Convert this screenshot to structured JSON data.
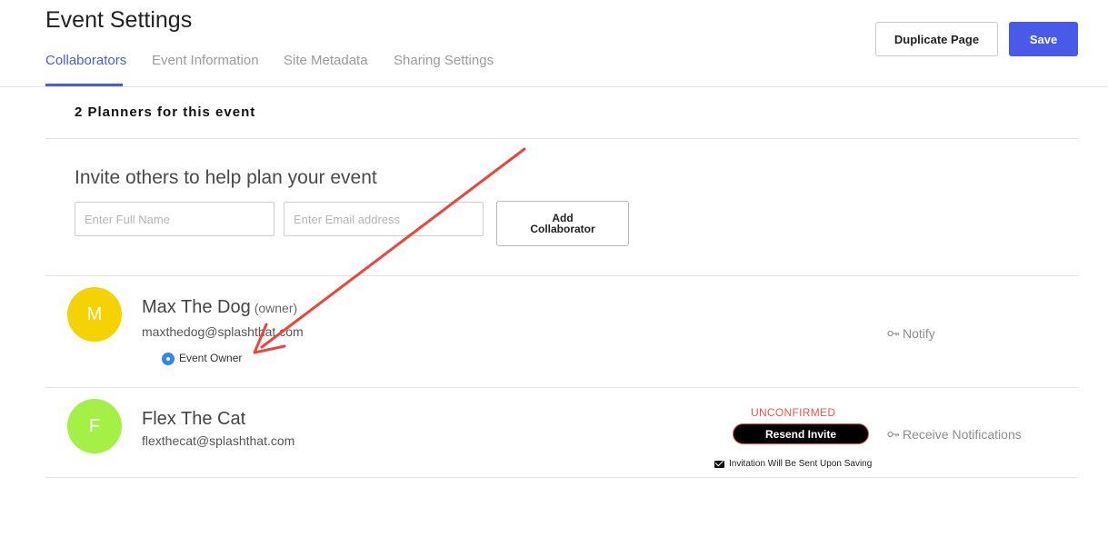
{
  "header": {
    "title": "Event Settings",
    "tabs": [
      {
        "label": "Collaborators",
        "active": true
      },
      {
        "label": "Event Information",
        "active": false
      },
      {
        "label": "Site Metadata",
        "active": false
      },
      {
        "label": "Sharing Settings",
        "active": false
      }
    ],
    "duplicate_label": "Duplicate Page",
    "save_label": "Save"
  },
  "planners": {
    "count_text": "2 Planners for this event"
  },
  "invite": {
    "heading": "Invite others to help plan your event",
    "name_placeholder": "Enter Full Name",
    "email_placeholder": "Enter Email address",
    "add_label": "Add Collaborator"
  },
  "collaborators": [
    {
      "initial": "M",
      "name": "Max The Dog",
      "owner_tag": "(owner)",
      "email": "maxthedog@splashthat.com",
      "role_label": "Event Owner",
      "notify_label": "Notify",
      "avatar_color": "#f5d300"
    },
    {
      "initial": "F",
      "name": "Flex The Cat",
      "email": "flexthecat@splashthat.com",
      "status": "UNCONFIRMED",
      "resend_label": "Resend Invite",
      "invite_note": "Invitation Will Be Sent Upon Saving",
      "notify_label": "Receive Notifications",
      "avatar_color": "#a5f046"
    }
  ],
  "colors": {
    "accent": "#4a5ae8",
    "status_red": "#e8574f",
    "annotation_arrow": "#f0443a"
  }
}
